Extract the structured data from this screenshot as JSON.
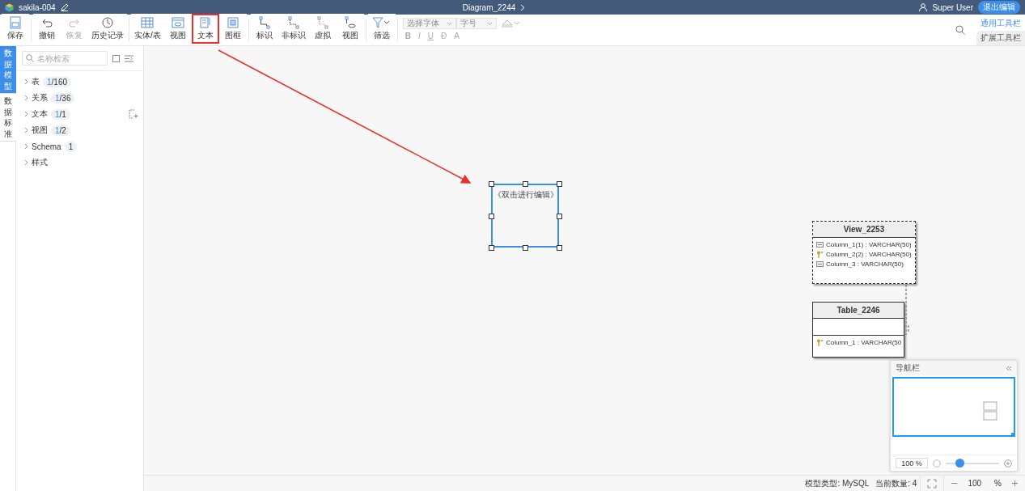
{
  "header": {
    "project": "sakila-004",
    "diagram": "Diagram_2244",
    "user": "Super User",
    "exit_button": "退出编辑"
  },
  "toolbar": {
    "groups": [
      [
        {
          "kind": "save",
          "label": "保存",
          "disabled": false,
          "highlighted": false
        }
      ],
      [
        {
          "kind": "undo",
          "label": "撤销",
          "disabled": false,
          "highlighted": false
        },
        {
          "kind": "redo",
          "label": "恢复",
          "disabled": true,
          "highlighted": false
        },
        {
          "kind": "history",
          "label": "历史记录",
          "disabled": false,
          "highlighted": false
        }
      ],
      [
        {
          "kind": "table",
          "label": "实体/表",
          "disabled": false,
          "highlighted": false
        },
        {
          "kind": "view",
          "label": "视图",
          "disabled": false,
          "highlighted": false
        },
        {
          "kind": "text",
          "label": "文本",
          "disabled": false,
          "highlighted": true
        },
        {
          "kind": "frame",
          "label": "图框",
          "disabled": false,
          "highlighted": false
        }
      ],
      [
        {
          "kind": "ident",
          "label": "标识",
          "disabled": false,
          "highlighted": false
        },
        {
          "kind": "nonident",
          "label": "非标识",
          "disabled": false,
          "highlighted": false
        },
        {
          "kind": "virtual",
          "label": "虚拟",
          "disabled": false,
          "highlighted": false
        },
        {
          "kind": "viewrel",
          "label": "视图",
          "disabled": false,
          "highlighted": false
        }
      ],
      [
        {
          "kind": "filter",
          "label": "筛选",
          "disabled": false,
          "highlighted": false
        }
      ]
    ],
    "font_select": {
      "placeholder": "选择字体"
    },
    "size_select": {
      "placeholder": "字号"
    },
    "format_buttons": [
      "B",
      "I",
      "U",
      "Đ",
      "A"
    ],
    "tabs": [
      {
        "label": "通用工具栏",
        "selected": false
      },
      {
        "label": "扩展工具栏",
        "selected": true
      }
    ]
  },
  "side_tabs": [
    {
      "label": "数据模型",
      "selected": true
    },
    {
      "label": "数据标准",
      "selected": false
    }
  ],
  "sidebar": {
    "search": {
      "placeholder": "名称检索"
    },
    "select_all": {
      "checked": false
    },
    "items": [
      {
        "label": "表",
        "count": "1",
        "total": "/160",
        "has_add": false
      },
      {
        "label": "关系",
        "count": "1",
        "total": "/36",
        "has_add": false
      },
      {
        "label": "文本",
        "count": "1",
        "total": "/1",
        "has_add": true
      },
      {
        "label": "视图",
        "count": "1",
        "total": "/2",
        "has_add": false
      },
      {
        "label": "Schema",
        "count": "1",
        "has_add": false
      },
      {
        "label": "样式",
        "has_add": false
      }
    ]
  },
  "canvas": {
    "text_note": {
      "text": "《双击进行编辑》",
      "selected": true
    },
    "view": {
      "title": "View_2253",
      "columns": [
        {
          "kind": "field",
          "text": "Column_1(1) : VARCHAR(50)"
        },
        {
          "kind": "key",
          "text": "Column_2(2) : VARCHAR(50)"
        },
        {
          "kind": "field",
          "text": "Column_3 : VARCHAR(50)"
        }
      ]
    },
    "table": {
      "title": "Table_2246",
      "columns": [
        {
          "kind": "key",
          "text": "Column_1 : VARCHAR(50"
        }
      ]
    },
    "navigator": {
      "title": "导航栏",
      "zoom": "100 %",
      "level": 0.25
    }
  },
  "status_bar": {
    "model_type": "模型类型: MySQL",
    "count": "当前数量: 4",
    "zoom": "100",
    "unit": "%"
  }
}
